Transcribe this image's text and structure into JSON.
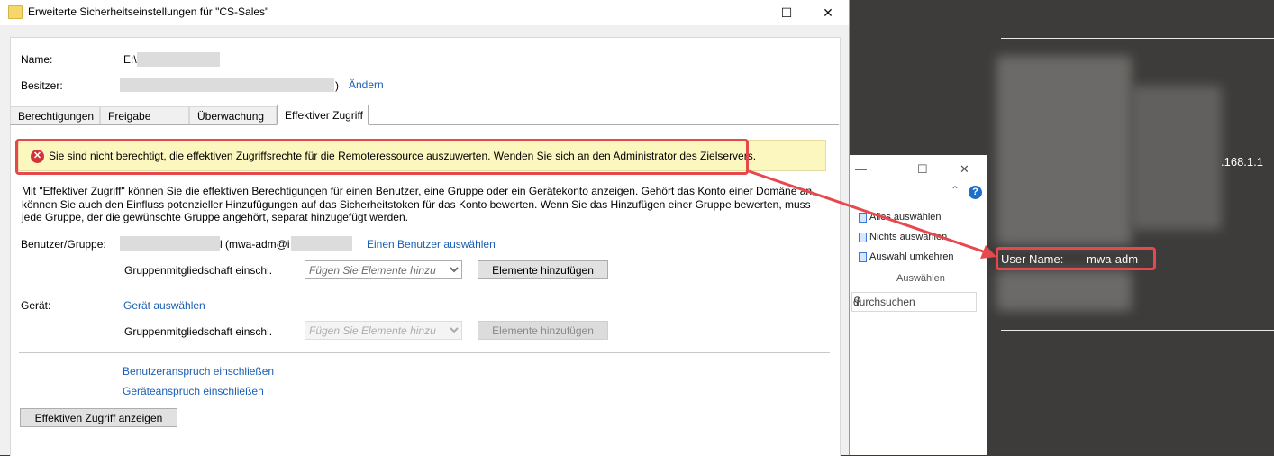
{
  "dialog": {
    "title": "Erweiterte Sicherheitseinstellungen für \"CS-Sales\"",
    "name_label": "Name:",
    "name_value": "E:\\",
    "owner_label": "Besitzer:",
    "owner_suffix": ")",
    "change_link": "Ändern",
    "tabs": [
      {
        "label": "Berechtigungen"
      },
      {
        "label": "Freigabe"
      },
      {
        "label": "Überwachung"
      },
      {
        "label": "Effektiver Zugriff"
      }
    ],
    "warning_text": "Sie sind nicht berechtigt, die effektiven Zugriffsrechte für die Remoteressource auszuwerten. Wenden Sie sich an den Administrator des Zielservers.",
    "description": "Mit \"Effektiver Zugriff\" können Sie die effektiven Berechtigungen für einen Benutzer, eine Gruppe oder ein Gerätekonto anzeigen. Gehört das Konto einer Domäne an, können Sie auch den Einfluss potenzieller Hinzufügungen auf das Sicherheitstoken für das Konto bewerten. Wenn Sie das Hinzufügen einer Gruppe bewerten, muss jede Gruppe, der die gewünschte Gruppe angehört, separat hinzugefügt werden.",
    "user_group_label": "Benutzer/Gruppe:",
    "user_value_start": "l (mwa-adm@i",
    "select_user_link": "Einen Benutzer auswählen",
    "group_membership_label": "Gruppenmitgliedschaft einschl.",
    "combo_placeholder": "Fügen Sie Elemente hinzu",
    "add_items_button": "Elemente hinzufügen",
    "device_label": "Gerät:",
    "select_device_link": "Gerät auswählen",
    "device_group_membership_label": "Gruppenmitgliedschaft einschl.",
    "device_combo_placeholder": "Fügen Sie Elemente hinzu",
    "device_add_items_button": "Elemente hinzufügen",
    "user_claim_link": "Benutzeranspruch einschließen",
    "device_claim_link": "Geräteanspruch einschließen",
    "show_access_button": "Effektiven Zugriff anzeigen"
  },
  "explorer": {
    "minimize": "—",
    "maximize": "☐",
    "close": "✕",
    "help": "?",
    "select_all": "Alles auswählen",
    "select_none": "Nichts auswählen",
    "invert_selection": "Auswahl umkehren",
    "group_label": "Auswählen",
    "search_placeholder": "durchsuchen"
  },
  "desktop": {
    "ip_fragment": ".168.1.1",
    "user_name_label": "User Name:",
    "user_name_value": "mwa-adm"
  },
  "colors": {
    "accent": "#1a5fb4",
    "warning_bg": "#fbf7bf",
    "error": "#d13438",
    "annotation": "#e5484d"
  }
}
